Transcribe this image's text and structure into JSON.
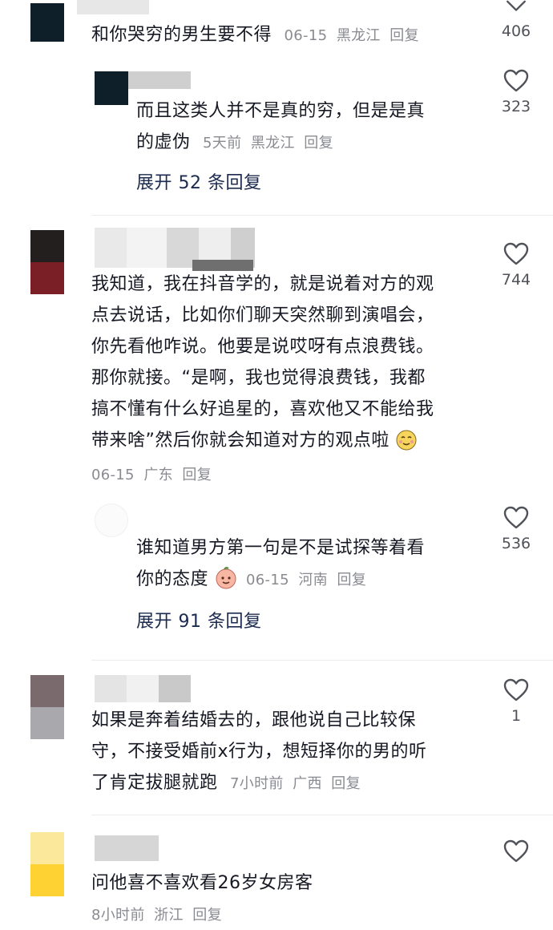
{
  "comments": [
    {
      "text": "和你哭穷的男生要不得",
      "date": "06-15",
      "region": "黑龙江",
      "reply": "回复",
      "likes": "406"
    },
    {
      "text_line1": "而且这类人并不是真的穷，但是是真",
      "text_line2": "的虚伪",
      "date": "5天前",
      "region": "黑龙江",
      "reply": "回复",
      "likes": "323",
      "expand": "展开 52 条回复"
    },
    {
      "lines": [
        "我知道，我在抖音学的，就是说着对方的观",
        "点去说话，比如你们聊天突然聊到演唱会，",
        "你先看他咋说。他要是说哎呀有点浪费钱。",
        "那你就接。“是啊，我也觉得浪费钱，我都",
        "搞不懂有什么好追星的，喜欢他又不能给我",
        "带来啥”然后你就会知道对方的观点啦"
      ],
      "date": "06-15",
      "region": "广东",
      "reply": "回复",
      "likes": "744",
      "emoji": "smirk-emoji"
    },
    {
      "text_line1": "谁知道男方第一句是不是试探等着看",
      "text_line2": "你的态度",
      "date": "06-15",
      "region": "河南",
      "reply": "回复",
      "likes": "536",
      "expand": "展开 91 条回复",
      "emoji": "peach-emoji"
    },
    {
      "lines": [
        "如果是奔着结婚去的，跟他说自己比较保",
        "守，不接受婚前x行为，想短择你的男的听",
        "了肯定拔腿就跑"
      ],
      "date": "7小时前",
      "region": "广西",
      "reply": "回复",
      "likes": "1"
    },
    {
      "text": "问他喜不喜欢看26岁女房客",
      "date": "8小时前",
      "region": "浙江",
      "reply": "回复"
    }
  ],
  "colors": {
    "text": "#161823",
    "meta": "#8a8b91",
    "expand": "#1b2a4f",
    "heart": "#505259"
  }
}
